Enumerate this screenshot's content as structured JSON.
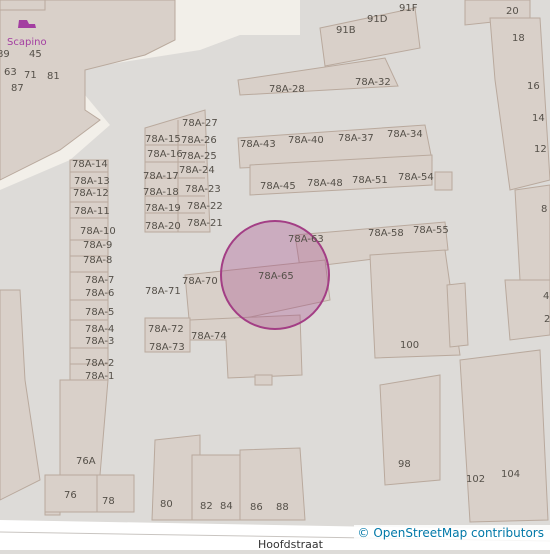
{
  "map": {
    "poi": {
      "name": "Scapino",
      "icon": "shoe-icon",
      "color": "#a33ea1"
    },
    "marker": {
      "type": "circle",
      "fill": "#a33e85",
      "stroke": "#a33e85"
    },
    "street": {
      "name": "Hoofdstraat"
    },
    "attribution": "© OpenStreetMap contributors",
    "house_numbers": [
      "89",
      "45",
      "63",
      "71",
      "81",
      "87",
      "91B",
      "91D",
      "91F",
      "20",
      "18",
      "16",
      "14",
      "12",
      "8",
      "4",
      "2",
      "78A-27",
      "78A-26",
      "78A-25",
      "78A-24",
      "78A-23",
      "78A-22",
      "78A-21",
      "78A-15",
      "78A-16",
      "78A-17",
      "78A-18",
      "78A-19",
      "78A-20",
      "78A-28",
      "78A-32",
      "78A-43",
      "78A-40",
      "78A-37",
      "78A-34",
      "78A-45",
      "78A-48",
      "78A-51",
      "78A-54",
      "78A-14",
      "78A-13",
      "78A-12",
      "78A-11",
      "78A-10",
      "78A-9",
      "78A-8",
      "78A-7",
      "78A-6",
      "78A-5",
      "78A-4",
      "78A-3",
      "78A-2",
      "78A-1",
      "78A-63",
      "78A-58",
      "78A-55",
      "78A-70",
      "78A-65",
      "78A-71",
      "78A-72",
      "78A-73",
      "78A-74",
      "76A",
      "76",
      "78",
      "80",
      "82",
      "84",
      "86",
      "88",
      "100",
      "98",
      "102",
      "104"
    ]
  }
}
